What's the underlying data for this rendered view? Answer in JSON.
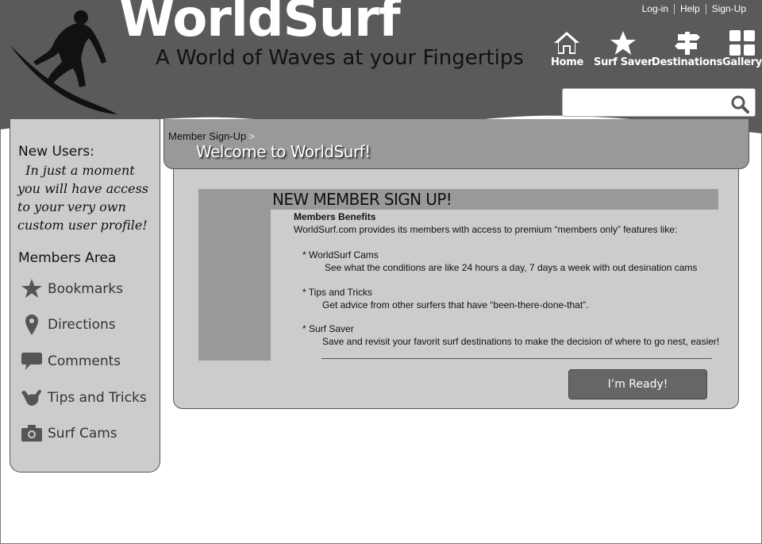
{
  "header": {
    "brand": "WorldSurf",
    "tagline": "A World of Waves at your Fingertips",
    "top_links": [
      "Log-in",
      "Help",
      "Sign-Up"
    ],
    "nav": [
      {
        "label": "Home",
        "icon": "home-icon"
      },
      {
        "label": "Surf Saver",
        "icon": "star-icon"
      },
      {
        "label": "Destinations",
        "icon": "signpost-icon"
      },
      {
        "label": "Gallery",
        "icon": "grid-icon"
      }
    ],
    "search": {
      "placeholder": "",
      "icon": "search-icon"
    }
  },
  "sidebar": {
    "new_users_title": "New Users:",
    "new_users_text": "In just a moment you will have access to your very own custom user profile!",
    "members_title": "Members Area",
    "items": [
      {
        "label": "Bookmarks",
        "icon": "star-icon"
      },
      {
        "label": "Directions",
        "icon": "map-pin-icon"
      },
      {
        "label": "Comments",
        "icon": "speech-bubble-icon"
      },
      {
        "label": "Tips and Tricks",
        "icon": "shaka-hand-icon"
      },
      {
        "label": "Surf Cams",
        "icon": "camera-icon"
      }
    ]
  },
  "breadcrumb": {
    "item": "Member Sign-Up",
    "separator": ">"
  },
  "welcome": "Welcome to WorldSurf!",
  "signup": {
    "title": "NEW MEMBER SIGN UP!",
    "benefits_heading": "Members Benefits",
    "intro": "WorldSurf.com provides its members with access to premium “members only” features like:",
    "benefits": [
      {
        "name": "* WorldSurf Cams",
        "desc": "See what the conditions are like 24 hours a day, 7 days a week with out desination cams"
      },
      {
        "name": "*  Tips and Tricks",
        "desc": "Get advice from other surfers that have “been-there-done-that”."
      },
      {
        "name": "* Surf Saver",
        "desc": "Save and revisit your favorit surf destinations to make the decision of where to go nest, easier!"
      }
    ],
    "button": "I’m Ready!"
  },
  "colors": {
    "header": "#5a5a5a",
    "panel": "#cccccc",
    "accent": "#999999",
    "button": "#666666"
  }
}
